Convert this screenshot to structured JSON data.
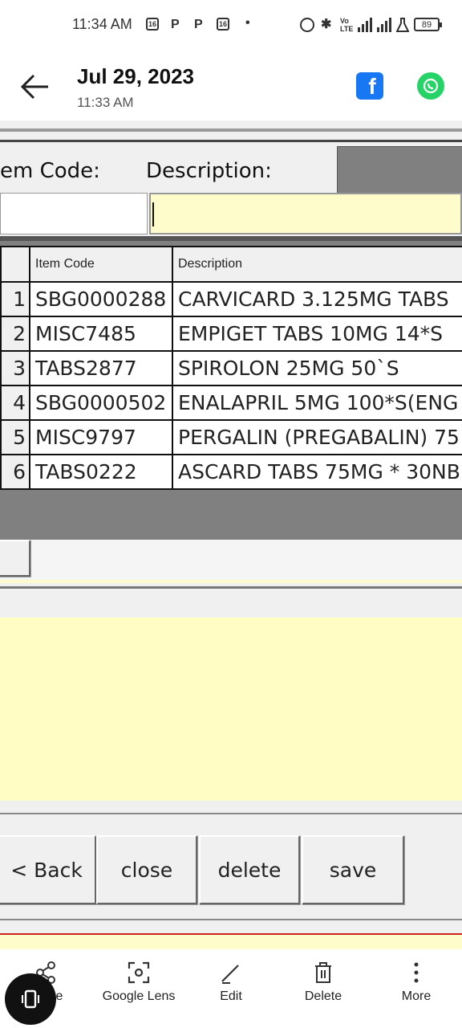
{
  "status_bar": {
    "time": "11:34 AM",
    "battery": "89"
  },
  "header": {
    "date": "Jul 29, 2023",
    "time": "11:33 AM"
  },
  "form": {
    "item_code_label": "em Code:",
    "description_label": "Description:"
  },
  "table": {
    "columns": [
      "Item Code",
      "Description"
    ],
    "rows": [
      {
        "num": "1",
        "code": "SBG0000288",
        "desc": "CARVICARD 3.125MG  TABS"
      },
      {
        "num": "2",
        "code": "MISC7485",
        "desc": "EMPIGET TABS 10MG 14*S"
      },
      {
        "num": "3",
        "code": "TABS2877",
        "desc": "SPIROLON 25MG 50`S"
      },
      {
        "num": "4",
        "code": "SBG0000502",
        "desc": "ENALAPRIL 5MG 100*S(ENG"
      },
      {
        "num": "5",
        "code": "MISC9797",
        "desc": "PERGALIN (PREGABALIN) 75"
      },
      {
        "num": "6",
        "code": "TABS0222",
        "desc": "ASCARD TABS 75MG * 30NB"
      }
    ]
  },
  "buttons": {
    "back": "< Back",
    "close": "close",
    "delete": "delete",
    "save": "save"
  },
  "bottom_bar": {
    "share": "Share",
    "lens": "Google Lens",
    "edit": "Edit",
    "delete": "Delete",
    "more": "More"
  }
}
